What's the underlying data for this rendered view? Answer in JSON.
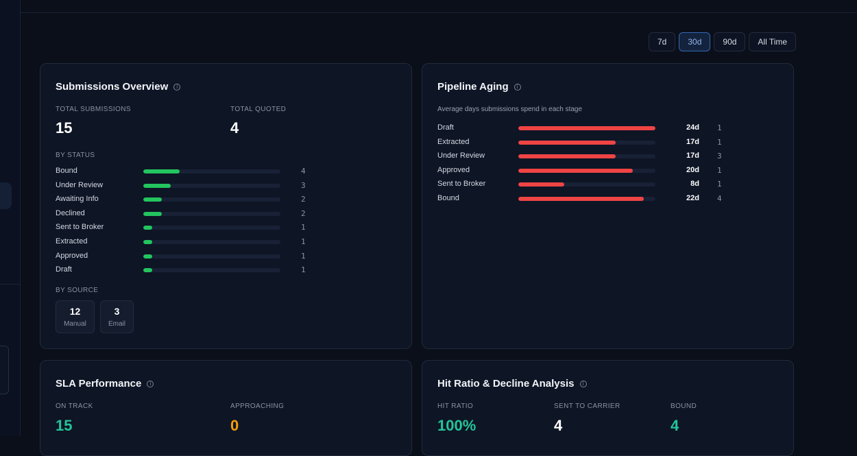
{
  "range_filters": [
    {
      "label": "7d",
      "active": false
    },
    {
      "label": "30d",
      "active": true
    },
    {
      "label": "90d",
      "active": false
    },
    {
      "label": "All Time",
      "active": false
    }
  ],
  "submissions": {
    "title": "Submissions Overview",
    "total_label": "TOTAL SUBMISSIONS",
    "total_value": "15",
    "quoted_label": "TOTAL QUOTED",
    "quoted_value": "4",
    "by_status_label": "BY STATUS",
    "max": 15,
    "status": [
      {
        "label": "Bound",
        "count": 4
      },
      {
        "label": "Under Review",
        "count": 3
      },
      {
        "label": "Awaiting Info",
        "count": 2
      },
      {
        "label": "Declined",
        "count": 2
      },
      {
        "label": "Sent to Broker",
        "count": 1
      },
      {
        "label": "Extracted",
        "count": 1
      },
      {
        "label": "Approved",
        "count": 1
      },
      {
        "label": "Draft",
        "count": 1
      }
    ],
    "by_source_label": "BY SOURCE",
    "sources": [
      {
        "value": "12",
        "label": "Manual"
      },
      {
        "value": "3",
        "label": "Email"
      }
    ]
  },
  "pipeline": {
    "title": "Pipeline Aging",
    "subtitle": "Average days submissions spend in each stage",
    "max_days": 24,
    "stages": [
      {
        "label": "Draft",
        "days": 24,
        "days_label": "24d",
        "count": 1
      },
      {
        "label": "Extracted",
        "days": 17,
        "days_label": "17d",
        "count": 1
      },
      {
        "label": "Under Review",
        "days": 17,
        "days_label": "17d",
        "count": 3
      },
      {
        "label": "Approved",
        "days": 20,
        "days_label": "20d",
        "count": 1
      },
      {
        "label": "Sent to Broker",
        "days": 8,
        "days_label": "8d",
        "count": 1
      },
      {
        "label": "Bound",
        "days": 22,
        "days_label": "22d",
        "count": 4
      }
    ]
  },
  "sla": {
    "title": "SLA Performance",
    "on_track_label": "ON TRACK",
    "on_track_value": "15",
    "approaching_label": "APPROACHING",
    "approaching_value": "0"
  },
  "hit_ratio": {
    "title": "Hit Ratio & Decline Analysis",
    "ratio_label": "HIT RATIO",
    "ratio_value": "100%",
    "sent_label": "SENT TO CARRIER",
    "sent_value": "4",
    "bound_label": "BOUND",
    "bound_value": "4"
  },
  "colors": {
    "green": "#22c55e",
    "red": "#ef4444",
    "accent_blue": "#3567b3",
    "on_track": "#22c59a",
    "approaching": "#f59e0b"
  },
  "icons": {
    "info": "info-circle-icon"
  }
}
